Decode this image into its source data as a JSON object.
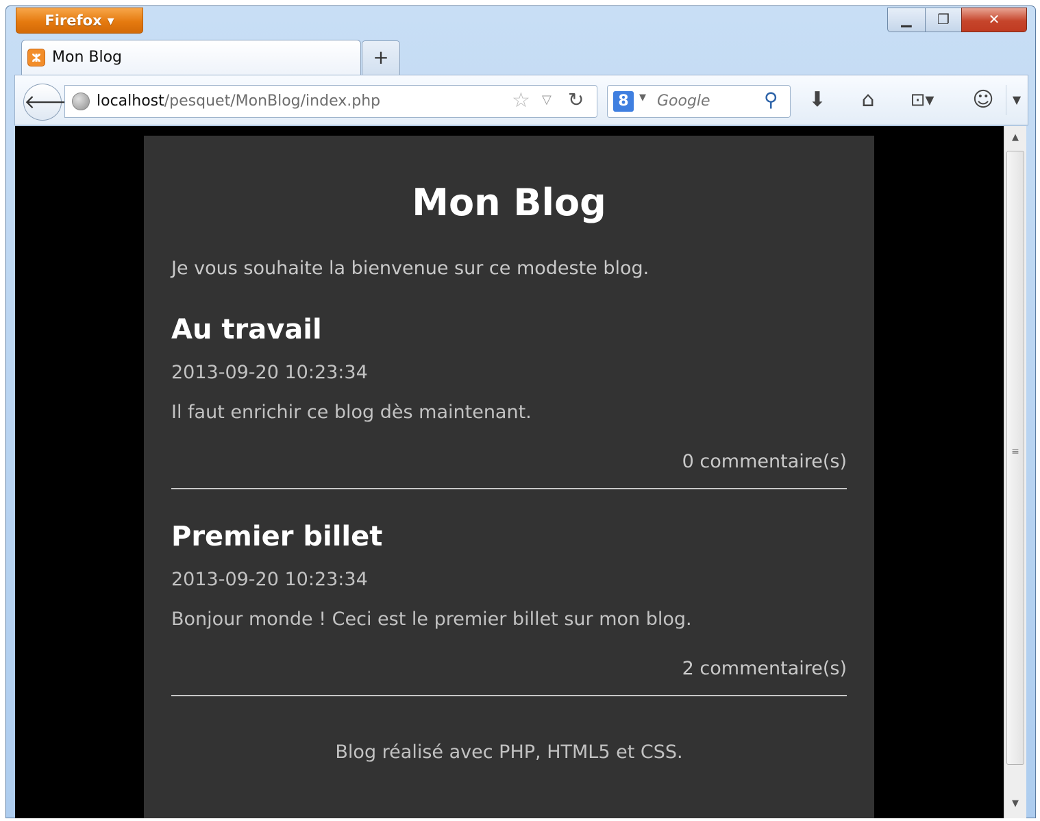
{
  "browser": {
    "app_button": "Firefox",
    "tab_title": "Mon Blog",
    "new_tab": "+",
    "url_host": "localhost",
    "url_path": "/pesquet/MonBlog/index.php",
    "search_placeholder": "Google",
    "icons": [
      "back-arrow-icon",
      "globe-icon",
      "star-icon",
      "reload-icon",
      "google-icon",
      "search-icon",
      "download-icon",
      "home-icon",
      "bookmarks-icon",
      "addon-icon",
      "menu-icon"
    ]
  },
  "blog": {
    "title": "Mon Blog",
    "intro": "Je vous souhaite la bienvenue sur ce modeste blog.",
    "posts": [
      {
        "title": "Au travail",
        "date": "2013-09-20 10:23:34",
        "body": "Il faut enrichir ce blog dès maintenant.",
        "comments": "0 commentaire(s)"
      },
      {
        "title": "Premier billet",
        "date": "2013-09-20 10:23:34",
        "body": "Bonjour monde ! Ceci est le premier billet sur mon blog.",
        "comments": "2 commentaire(s)"
      }
    ],
    "footer": "Blog réalisé avec PHP, HTML5 et CSS."
  },
  "colors": {
    "page_bg": "#000000",
    "content_bg": "#333333",
    "heading": "#ffffff",
    "text": "#c2c2c2",
    "firefox_orange": "#e57a0f"
  }
}
